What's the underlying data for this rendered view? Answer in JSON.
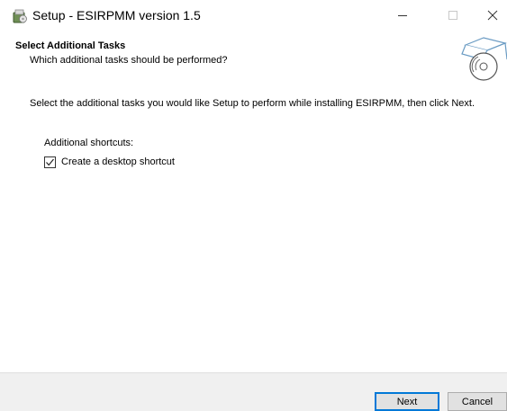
{
  "window": {
    "title": "Setup - ESIRPMM version 1.5",
    "icon": "setup-installer-icon",
    "controls": [
      "minimize-icon",
      "maximize-icon",
      "close-icon"
    ]
  },
  "header": {
    "title": "Select Additional Tasks",
    "subtitle": "Which additional tasks should be performed?",
    "image": "wizard-box-disc-icon"
  },
  "body": {
    "intro": "Select the additional tasks you would like Setup to perform while installing ESIRPMM, then click Next.",
    "group_label": "Additional shortcuts:",
    "tasks": [
      {
        "label": "Create a desktop shortcut",
        "checked": true
      }
    ]
  },
  "footer": {
    "next_label": "Next",
    "cancel_label": "Cancel"
  },
  "colors": {
    "accent": "#0078d7",
    "footer_bg": "#f0f0f0"
  }
}
